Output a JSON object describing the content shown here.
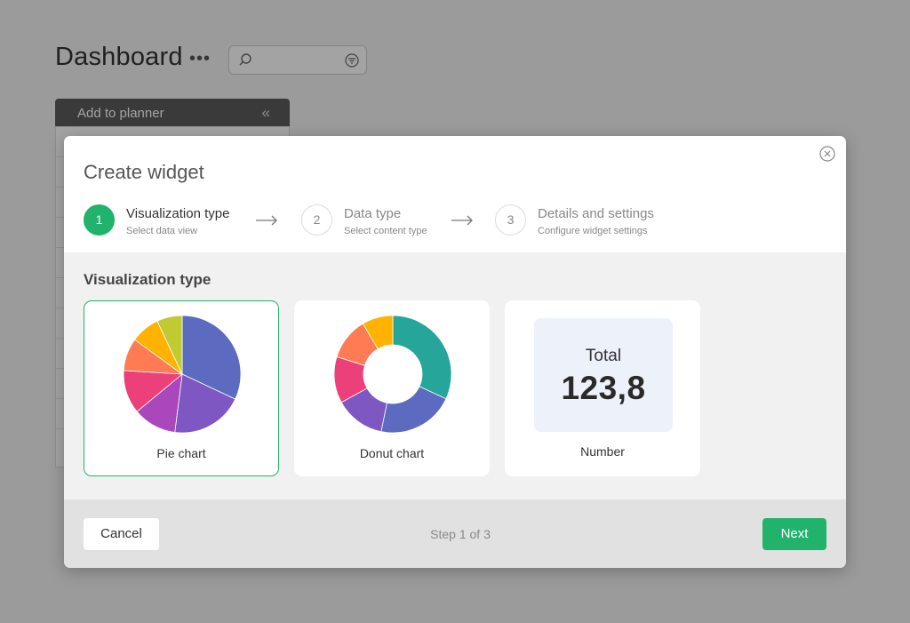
{
  "background": {
    "title": "Dashboard",
    "menu_glyph": "•••",
    "panel_label": "Add to planner",
    "panel_chevron": "«",
    "icons": [
      "search-icon",
      "filter-icon",
      "collapse-chevron-icon"
    ]
  },
  "modal": {
    "title": "Create widget",
    "steps": [
      {
        "number": "1",
        "title": "Visualization type",
        "subtitle": "Select data view",
        "active": true
      },
      {
        "number": "2",
        "title": "Data type",
        "subtitle": "Select content type",
        "active": false
      },
      {
        "number": "3",
        "title": "Details and settings",
        "subtitle": "Configure widget settings",
        "active": false
      }
    ],
    "section_title": "Visualization type",
    "options": [
      {
        "label": "Pie chart",
        "selected": true
      },
      {
        "label": "Donut chart",
        "selected": false
      },
      {
        "label": "Number",
        "selected": false,
        "preview_label": "Total",
        "preview_value": "123,8"
      }
    ],
    "footer": {
      "cancel_label": "Cancel",
      "step_indicator": "Step 1 of 3",
      "next_label": "Next"
    }
  },
  "colors": {
    "accent": "#21b36b",
    "overlay": "rgba(0,0,0,0.36)",
    "number_preview_bg": "#edf1fa"
  },
  "pie_preview": {
    "slices": [
      {
        "value": 32,
        "color": "#5c6bc0"
      },
      {
        "value": 20,
        "color": "#7e57c2"
      },
      {
        "value": 12,
        "color": "#ab47bc"
      },
      {
        "value": 12,
        "color": "#ec407a"
      },
      {
        "value": 9,
        "color": "#ff7b54"
      },
      {
        "value": 8,
        "color": "#ffb300"
      },
      {
        "value": 7,
        "color": "#c0ca33"
      }
    ]
  },
  "donut_preview": {
    "slices": [
      {
        "value": 30,
        "color": "#26a69a"
      },
      {
        "value": 20,
        "color": "#5c6bc0"
      },
      {
        "value": 13,
        "color": "#7e57c2"
      },
      {
        "value": 12,
        "color": "#ec407a"
      },
      {
        "value": 11,
        "color": "#ff7b54"
      },
      {
        "value": 8,
        "color": "#ffb300"
      }
    ]
  }
}
